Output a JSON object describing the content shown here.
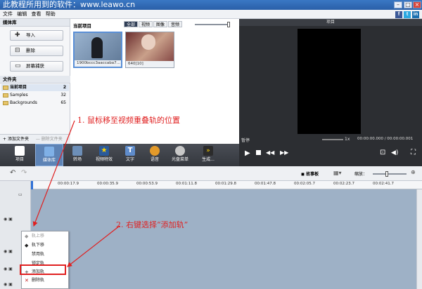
{
  "window": {
    "title": "此教程所用到的软件：www.leawo.cn"
  },
  "menu": [
    "文件",
    "编辑",
    "查看",
    "帮助"
  ],
  "social": [
    "f",
    "t",
    "in"
  ],
  "media_library": {
    "title": "媒体库",
    "buttons": [
      "导入",
      "删除",
      "屏幕捕获"
    ],
    "folder_title": "文件夹",
    "folders": [
      {
        "name": "当前项目",
        "count": "2"
      },
      {
        "name": "Samples",
        "count": "32"
      },
      {
        "name": "Backgrounds",
        "count": "65"
      }
    ],
    "add_folder": "添加文件夹",
    "delete_folder": "删除文件夹"
  },
  "project": {
    "title": "当前项目",
    "tabs": [
      "全部",
      "视频",
      "图像",
      "音频"
    ],
    "thumbs": [
      "1900bccc3aaccaba7...",
      "640[10]"
    ]
  },
  "preview": {
    "title": "项目",
    "status": "暂停",
    "speed": "1x",
    "time": "00:00:00.000 / 00:00:00.001"
  },
  "toolbar": {
    "items": [
      "项目",
      "媒体库",
      "转场",
      "视频特效",
      "文字",
      "语音",
      "光盘菜单",
      "生成..."
    ],
    "selected": 1
  },
  "timeline": {
    "storyboard": "故事板",
    "zoom_label": "缩放：",
    "ticks": [
      "00:00:17.9",
      "00:00:35.9",
      "00:00:53.9",
      "00:01:11.8",
      "00:01:29.8",
      "00:01:47.8",
      "00:02:05.7",
      "00:02:23.7",
      "00:02:41.7"
    ]
  },
  "context_menu": [
    {
      "label": "轨上移",
      "disabled": true
    },
    {
      "label": "轨下移",
      "disabled": false
    },
    {
      "label": "禁用轨",
      "disabled": false
    },
    {
      "label": "锁定轨",
      "disabled": false
    },
    {
      "label": "添加轨",
      "disabled": false
    },
    {
      "label": "删除轨",
      "disabled": false
    }
  ],
  "annotations": {
    "step1": "1. 鼠标移至视频重叠轨的位置",
    "step2": "2. 右键选择“添加轨”"
  },
  "colors": {
    "accent": "#e02020",
    "titlebar": "#2f66b0",
    "track": "#9eb1c6"
  }
}
